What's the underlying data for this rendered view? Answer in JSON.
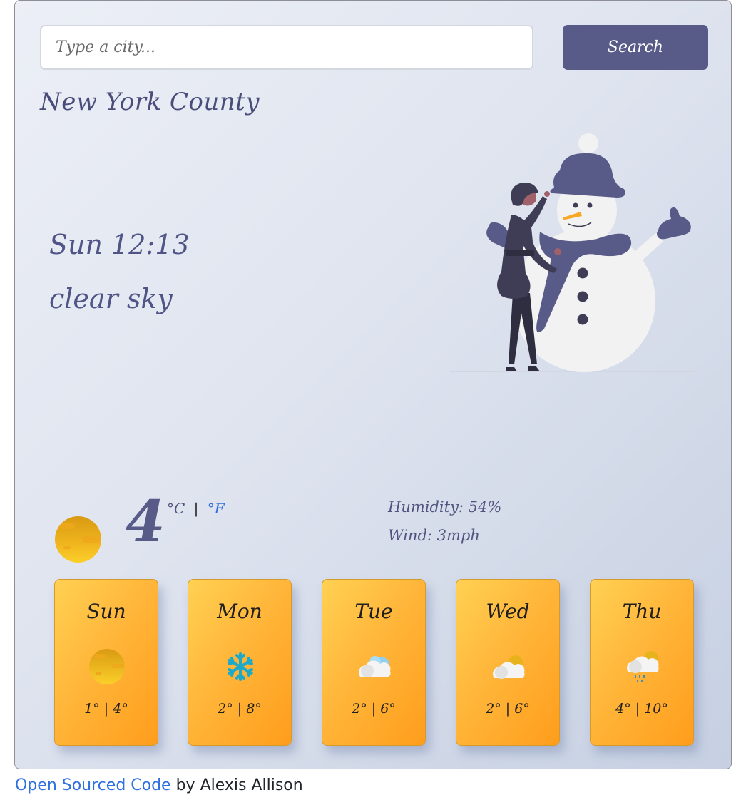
{
  "search": {
    "placeholder": "Type a city...",
    "value": "",
    "button_label": "Search"
  },
  "current": {
    "city": "New York County",
    "datetime": "Sun 12:13",
    "description": "clear sky",
    "icon": "sun-icon",
    "temperature": "4",
    "unit_celsius": "°C",
    "unit_separator": "|",
    "unit_fahrenheit": "°F",
    "humidity_label": "Humidity: 54%",
    "wind_label": "Wind: 3mph"
  },
  "illustration": {
    "name": "snowman-illustration",
    "colors": {
      "hat": "#585a88",
      "snow": "#f2f2f2",
      "person": "#3f3d56",
      "carrot": "#f9a826"
    }
  },
  "forecast": [
    {
      "day": "Sun",
      "icon": "sun-icon",
      "range": "1° | 4°"
    },
    {
      "day": "Mon",
      "icon": "snowflake-icon",
      "range": "2° | 8°"
    },
    {
      "day": "Tue",
      "icon": "cloudy-icon",
      "range": "2° | 6°"
    },
    {
      "day": "Wed",
      "icon": "partly-cloudy-icon",
      "range": "2° | 6°"
    },
    {
      "day": "Thu",
      "icon": "rain-sun-icon",
      "range": "4° | 10°"
    }
  ],
  "footer": {
    "link_label": "Open Sourced Code",
    "suffix": " by Alexis Allison"
  },
  "colors": {
    "accent": "#585a88",
    "card_start": "#ffd153",
    "card_end": "#ff9d1c",
    "link": "#2f6fe0"
  }
}
